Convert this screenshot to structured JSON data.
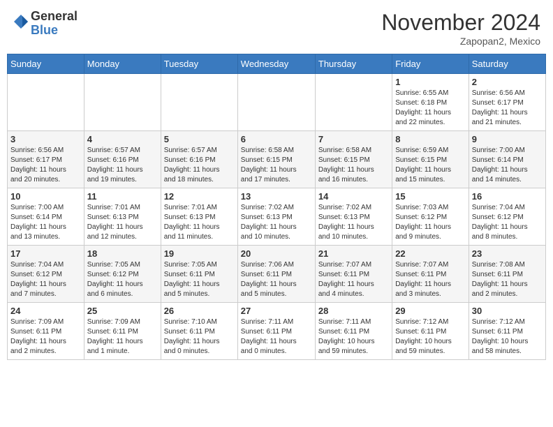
{
  "header": {
    "logo_general": "General",
    "logo_blue": "Blue",
    "month_title": "November 2024",
    "location": "Zapopan2, Mexico"
  },
  "weekdays": [
    "Sunday",
    "Monday",
    "Tuesday",
    "Wednesday",
    "Thursday",
    "Friday",
    "Saturday"
  ],
  "weeks": [
    [
      {
        "day": "",
        "info": ""
      },
      {
        "day": "",
        "info": ""
      },
      {
        "day": "",
        "info": ""
      },
      {
        "day": "",
        "info": ""
      },
      {
        "day": "",
        "info": ""
      },
      {
        "day": "1",
        "info": "Sunrise: 6:55 AM\nSunset: 6:18 PM\nDaylight: 11 hours\nand 22 minutes."
      },
      {
        "day": "2",
        "info": "Sunrise: 6:56 AM\nSunset: 6:17 PM\nDaylight: 11 hours\nand 21 minutes."
      }
    ],
    [
      {
        "day": "3",
        "info": "Sunrise: 6:56 AM\nSunset: 6:17 PM\nDaylight: 11 hours\nand 20 minutes."
      },
      {
        "day": "4",
        "info": "Sunrise: 6:57 AM\nSunset: 6:16 PM\nDaylight: 11 hours\nand 19 minutes."
      },
      {
        "day": "5",
        "info": "Sunrise: 6:57 AM\nSunset: 6:16 PM\nDaylight: 11 hours\nand 18 minutes."
      },
      {
        "day": "6",
        "info": "Sunrise: 6:58 AM\nSunset: 6:15 PM\nDaylight: 11 hours\nand 17 minutes."
      },
      {
        "day": "7",
        "info": "Sunrise: 6:58 AM\nSunset: 6:15 PM\nDaylight: 11 hours\nand 16 minutes."
      },
      {
        "day": "8",
        "info": "Sunrise: 6:59 AM\nSunset: 6:15 PM\nDaylight: 11 hours\nand 15 minutes."
      },
      {
        "day": "9",
        "info": "Sunrise: 7:00 AM\nSunset: 6:14 PM\nDaylight: 11 hours\nand 14 minutes."
      }
    ],
    [
      {
        "day": "10",
        "info": "Sunrise: 7:00 AM\nSunset: 6:14 PM\nDaylight: 11 hours\nand 13 minutes."
      },
      {
        "day": "11",
        "info": "Sunrise: 7:01 AM\nSunset: 6:13 PM\nDaylight: 11 hours\nand 12 minutes."
      },
      {
        "day": "12",
        "info": "Sunrise: 7:01 AM\nSunset: 6:13 PM\nDaylight: 11 hours\nand 11 minutes."
      },
      {
        "day": "13",
        "info": "Sunrise: 7:02 AM\nSunset: 6:13 PM\nDaylight: 11 hours\nand 10 minutes."
      },
      {
        "day": "14",
        "info": "Sunrise: 7:02 AM\nSunset: 6:13 PM\nDaylight: 11 hours\nand 10 minutes."
      },
      {
        "day": "15",
        "info": "Sunrise: 7:03 AM\nSunset: 6:12 PM\nDaylight: 11 hours\nand 9 minutes."
      },
      {
        "day": "16",
        "info": "Sunrise: 7:04 AM\nSunset: 6:12 PM\nDaylight: 11 hours\nand 8 minutes."
      }
    ],
    [
      {
        "day": "17",
        "info": "Sunrise: 7:04 AM\nSunset: 6:12 PM\nDaylight: 11 hours\nand 7 minutes."
      },
      {
        "day": "18",
        "info": "Sunrise: 7:05 AM\nSunset: 6:12 PM\nDaylight: 11 hours\nand 6 minutes."
      },
      {
        "day": "19",
        "info": "Sunrise: 7:05 AM\nSunset: 6:11 PM\nDaylight: 11 hours\nand 5 minutes."
      },
      {
        "day": "20",
        "info": "Sunrise: 7:06 AM\nSunset: 6:11 PM\nDaylight: 11 hours\nand 5 minutes."
      },
      {
        "day": "21",
        "info": "Sunrise: 7:07 AM\nSunset: 6:11 PM\nDaylight: 11 hours\nand 4 minutes."
      },
      {
        "day": "22",
        "info": "Sunrise: 7:07 AM\nSunset: 6:11 PM\nDaylight: 11 hours\nand 3 minutes."
      },
      {
        "day": "23",
        "info": "Sunrise: 7:08 AM\nSunset: 6:11 PM\nDaylight: 11 hours\nand 2 minutes."
      }
    ],
    [
      {
        "day": "24",
        "info": "Sunrise: 7:09 AM\nSunset: 6:11 PM\nDaylight: 11 hours\nand 2 minutes."
      },
      {
        "day": "25",
        "info": "Sunrise: 7:09 AM\nSunset: 6:11 PM\nDaylight: 11 hours\nand 1 minute."
      },
      {
        "day": "26",
        "info": "Sunrise: 7:10 AM\nSunset: 6:11 PM\nDaylight: 11 hours\nand 0 minutes."
      },
      {
        "day": "27",
        "info": "Sunrise: 7:11 AM\nSunset: 6:11 PM\nDaylight: 11 hours\nand 0 minutes."
      },
      {
        "day": "28",
        "info": "Sunrise: 7:11 AM\nSunset: 6:11 PM\nDaylight: 10 hours\nand 59 minutes."
      },
      {
        "day": "29",
        "info": "Sunrise: 7:12 AM\nSunset: 6:11 PM\nDaylight: 10 hours\nand 59 minutes."
      },
      {
        "day": "30",
        "info": "Sunrise: 7:12 AM\nSunset: 6:11 PM\nDaylight: 10 hours\nand 58 minutes."
      }
    ]
  ]
}
